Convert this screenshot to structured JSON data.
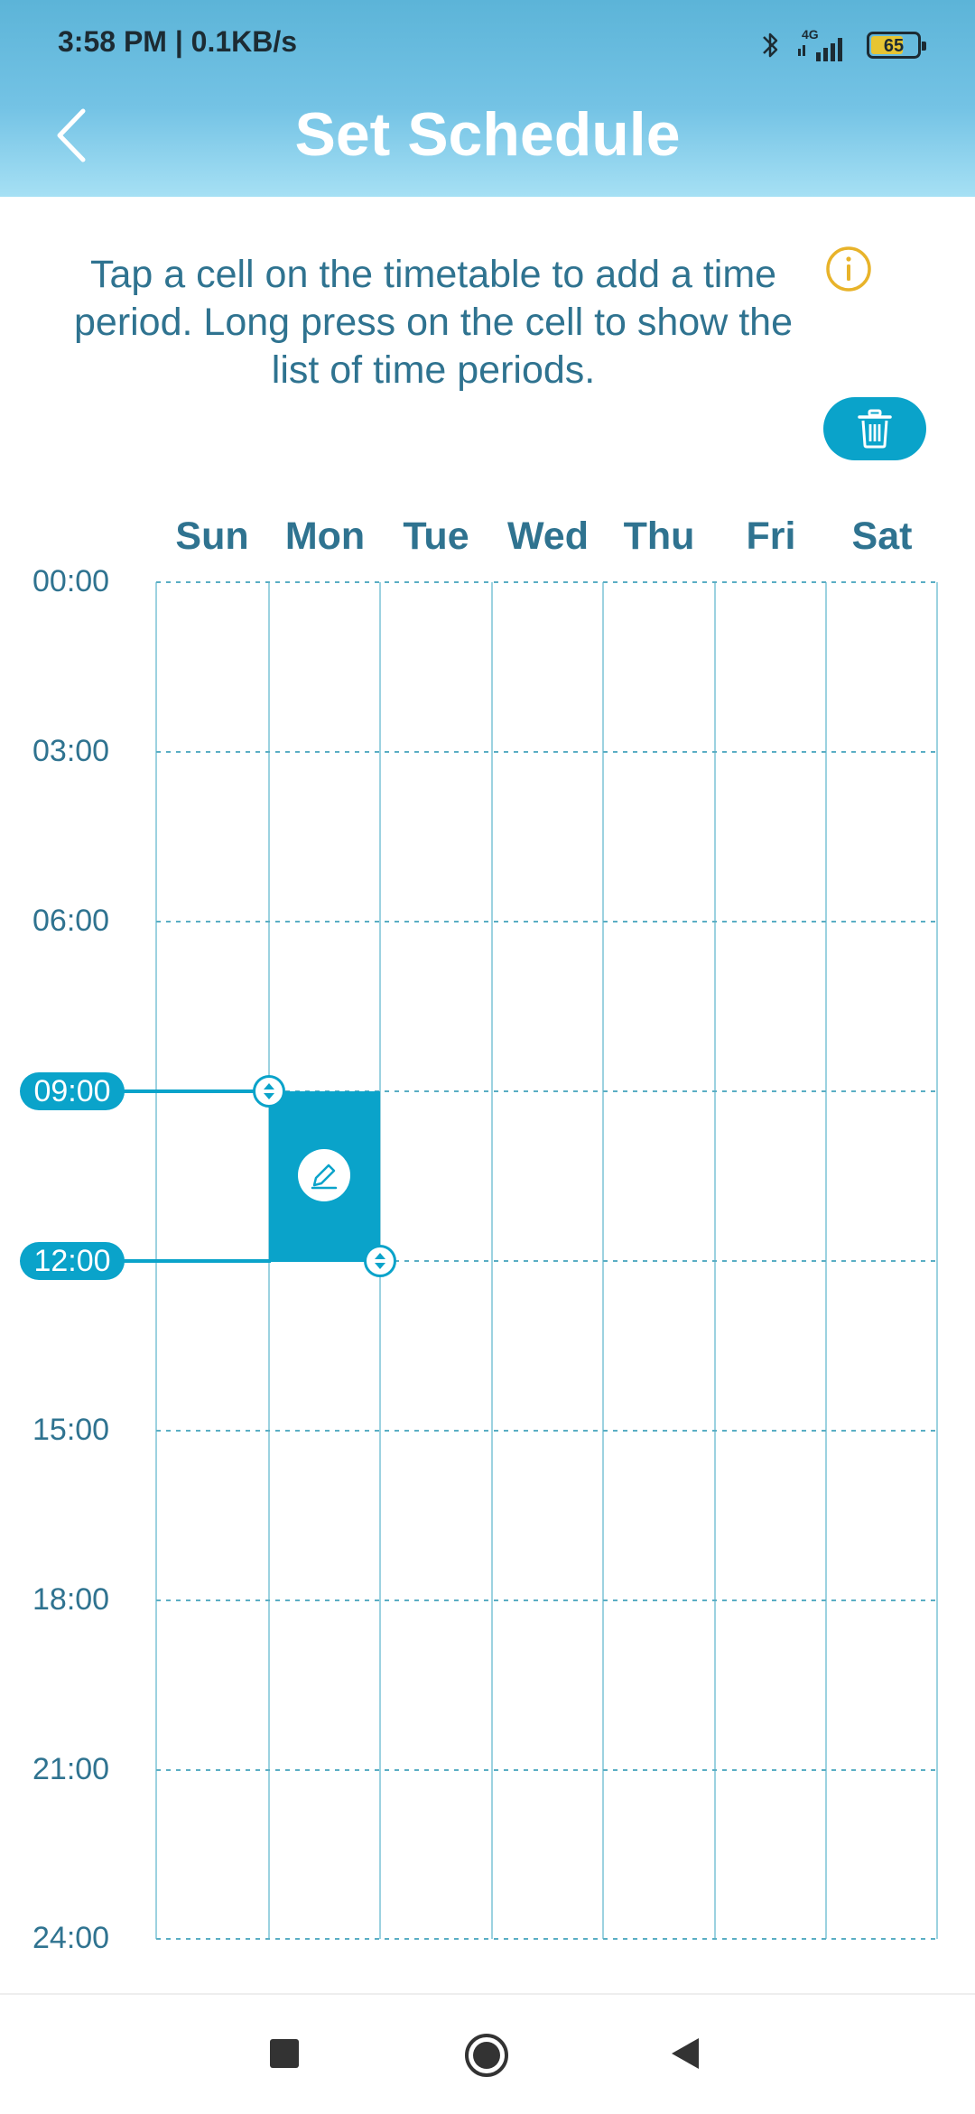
{
  "status_bar": {
    "time": "3:58 PM | 0.1KB/s",
    "network": "4G",
    "battery": "65"
  },
  "header": {
    "title": "Set Schedule"
  },
  "instruction": "Tap a cell on the timetable to add a time period. Long press on the cell to show the list of time periods.",
  "days": [
    "Sun",
    "Mon",
    "Tue",
    "Wed",
    "Thu",
    "Fri",
    "Sat"
  ],
  "times": [
    "00:00",
    "03:00",
    "06:00",
    "09:00",
    "12:00",
    "15:00",
    "18:00",
    "21:00",
    "24:00"
  ],
  "selected_period": {
    "day": "Mon",
    "start": "09:00",
    "end": "12:00"
  },
  "colors": {
    "accent": "#0aa3ca",
    "text": "#2f7390",
    "info": "#e8b32a",
    "grid": "#7cc4d6"
  }
}
